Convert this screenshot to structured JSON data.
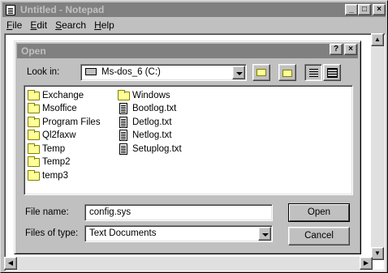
{
  "notepad": {
    "title": "Untitled - Notepad",
    "menu": [
      "File",
      "Edit",
      "Search",
      "Help"
    ],
    "controls": {
      "minimize": "_",
      "maximize": "□",
      "close": "×"
    }
  },
  "dialog": {
    "title": "Open",
    "help_glyph": "?",
    "close_glyph": "×",
    "look_in_label": "Look in:",
    "look_in_value": "Ms-dos_6 (C:)",
    "toolbar": [
      "up-one-level-icon",
      "create-new-folder-icon",
      "list-view-icon",
      "details-view-icon"
    ],
    "folders": [
      "Exchange",
      "Msoffice",
      "Program Files",
      "Ql2faxw",
      "Temp",
      "Temp2",
      "temp3",
      "Windows"
    ],
    "files": [
      "Bootlog.txt",
      "Detlog.txt",
      "Netlog.txt",
      "Setuplog.txt"
    ],
    "file_name_label": "File name:",
    "file_name_value": "config.sys",
    "files_of_type_label": "Files of type:",
    "files_of_type_value": "Text Documents",
    "open_button": "Open",
    "cancel_button": "Cancel"
  }
}
